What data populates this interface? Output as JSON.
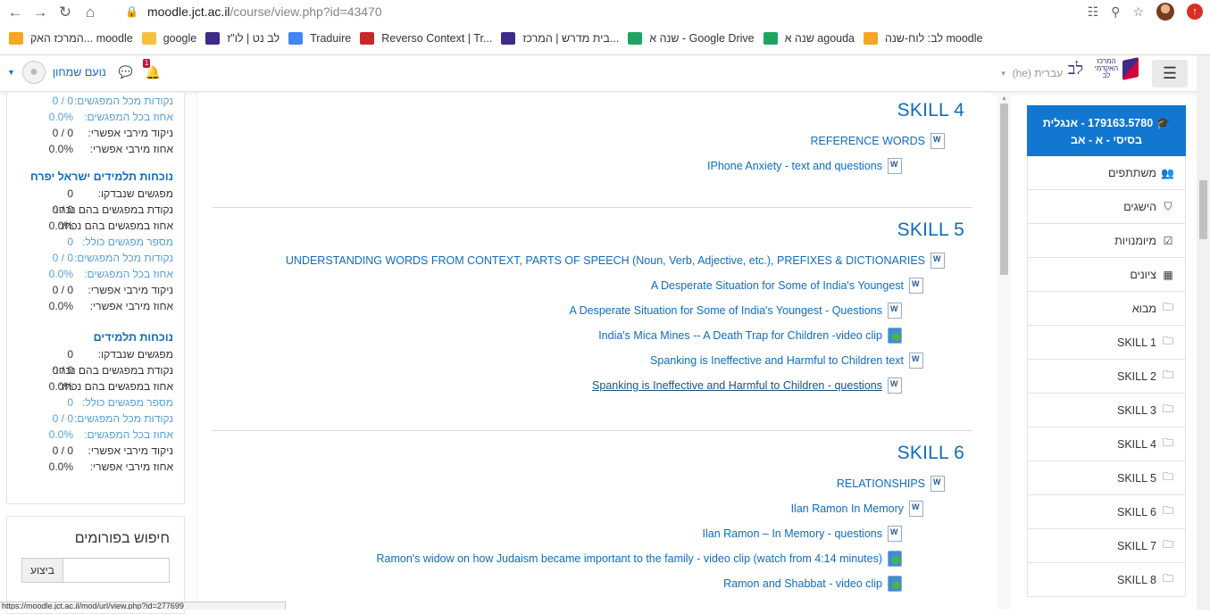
{
  "browser": {
    "url_host": "moodle.jct.ac.il",
    "url_path": "/course/view.php?id=43470",
    "bookmarks": [
      {
        "label": "לב: לוח-שנה moodle",
        "color": "#f5a623"
      },
      {
        "label": "שנה א agouda",
        "color": "#1fa463"
      },
      {
        "label": "שנה א - Google Drive",
        "color": "#1fa463"
      },
      {
        "label": "בית מדרש | המרכז...",
        "color": "#3e2b86"
      },
      {
        "label": "Reverso Context | Tr...",
        "color": "#c62828"
      },
      {
        "label": "Traduire",
        "color": "#4285f4"
      },
      {
        "label": "לב נט | לו\"ז",
        "color": "#3e2b86"
      },
      {
        "label": "google",
        "color": "#f6c23e"
      },
      {
        "label": "המרכז האק... moodle",
        "color": "#f5a623"
      }
    ],
    "status_url": "https://moodle.jct.ac.il/mod/url/view.php?id=277699"
  },
  "navbar": {
    "brand_text": "המרכז האקדמי לב",
    "brand_lev": "לב",
    "language": "עברית (he)",
    "user_name": "נועם שמחון",
    "notifications_count": "1"
  },
  "left_panel": {
    "rows_top": [
      {
        "label": "נקודות מכל המפגשים:",
        "value": "0 / 0",
        "muted": true
      },
      {
        "label": "אחוז בכל המפגשים:",
        "value": "0.0%",
        "muted": true
      },
      {
        "label": "ניקוד מירבי אפשרי:",
        "value": "0 / 0",
        "muted": false
      },
      {
        "label": "אחוז מירבי אפשרי:",
        "value": "0.0%",
        "muted": false
      }
    ],
    "group1_title": "נוכחות תלמידים ישראל יפרח",
    "group1_rows": [
      {
        "label": "מפגשים שנבדקו:",
        "value": "0",
        "muted": false
      },
      {
        "label": "נקודת במפגשים בהם נכחו:",
        "value": "0 / 0",
        "muted": false
      },
      {
        "label": "אחוז במפגשים בהם נכחו:",
        "value": "0.0%",
        "muted": false
      },
      {
        "label": "מספר מפגשים כולל:",
        "value": "0",
        "muted": true
      },
      {
        "label": "נקודות מכל המפגשים:",
        "value": "0 / 0",
        "muted": true
      },
      {
        "label": "אחוז בכל המפגשים:",
        "value": "0.0%",
        "muted": true
      },
      {
        "label": "ניקוד מירבי אפשרי:",
        "value": "0 / 0",
        "muted": false
      },
      {
        "label": "אחוז מירבי אפשרי:",
        "value": "0.0%",
        "muted": false
      }
    ],
    "group2_title": "נוכחות תלמידים",
    "group2_rows": [
      {
        "label": "מפגשים שנבדקו:",
        "value": "0",
        "muted": false
      },
      {
        "label": "נקודת במפגשים בהם נכחו:",
        "value": "0 / 0",
        "muted": false
      },
      {
        "label": "אחוז במפגשים בהם נכחו:",
        "value": "0.0%",
        "muted": false
      },
      {
        "label": "מספר מפגשים כולל:",
        "value": "0",
        "muted": true
      },
      {
        "label": "נקודות מכל המפגשים:",
        "value": "0 / 0",
        "muted": true
      },
      {
        "label": "אחוז בכל המפגשים:",
        "value": "0.0%",
        "muted": true
      },
      {
        "label": "ניקוד מירבי אפשרי:",
        "value": "0 / 0",
        "muted": false
      },
      {
        "label": "אחוז מירבי אפשרי:",
        "value": "0.0%",
        "muted": false
      }
    ],
    "search_title": "חיפוש בפורומים",
    "search_button": "ביצוע"
  },
  "sections": [
    {
      "title": "SKILL 4",
      "activities": [
        {
          "label": "REFERENCE WORDS",
          "icon": "word-icon",
          "type": "word"
        },
        {
          "label": "IPhone Anxiety - text and questions",
          "icon": "word-icon",
          "type": "word",
          "indent": true
        }
      ]
    },
    {
      "title": "SKILL 5",
      "activities": [
        {
          "label": "UNDERSTANDING WORDS FROM CONTEXT, PARTS OF SPEECH (Noun, Verb, Adjective, etc.), PREFIXES & DICTIONARIES",
          "icon": "word-icon",
          "type": "word"
        },
        {
          "label": "A Desperate Situation for Some of India's Youngest",
          "icon": "word-icon",
          "type": "word",
          "indent1": true
        },
        {
          "label": "A Desperate Situation for Some of India's Youngest - Questions",
          "icon": "word-icon",
          "type": "word",
          "indent": true
        },
        {
          "label": "India's Mica Mines -- A Death Trap for Children -video clip",
          "icon": "url-icon",
          "type": "url",
          "indent": true
        },
        {
          "label": "Spanking is Ineffective and Harmful to Children text",
          "icon": "word-icon",
          "type": "word",
          "indent1": true
        },
        {
          "label": "Spanking is Ineffective and Harmful to Children - questions",
          "icon": "word-icon",
          "type": "word",
          "indent": true,
          "hover": true
        }
      ]
    },
    {
      "title": "SKILL 6",
      "activities": [
        {
          "label": "RELATIONSHIPS",
          "icon": "word-icon",
          "type": "word"
        },
        {
          "label": "Ilan Ramon In Memory",
          "icon": "word-icon",
          "type": "word",
          "indent1": true
        },
        {
          "label": "Ilan Ramon – In Memory - questions",
          "icon": "word-icon",
          "type": "word",
          "indent": true
        },
        {
          "label": "Ramon's widow on how Judaism became important to the family - video clip (watch from 4:14 minutes)",
          "icon": "url-icon",
          "type": "url",
          "indent": true
        },
        {
          "label": "Ramon and Shabbat - video clip",
          "icon": "url-icon",
          "type": "url",
          "indent": true
        }
      ]
    }
  ],
  "drawer": {
    "course_title": "179163.5780 - אנגלית בסיסי - א - אב",
    "items": [
      {
        "label": "משתתפים",
        "icon": "users-icon",
        "glyph": "👥"
      },
      {
        "label": "הישגים",
        "icon": "shield-icon",
        "glyph": "⛉"
      },
      {
        "label": "מיומנויות",
        "icon": "checkbox-icon",
        "glyph": "☑"
      },
      {
        "label": "ציונים",
        "icon": "table-icon",
        "glyph": "▦"
      },
      {
        "label": "מבוא",
        "icon": "folder-icon",
        "glyph": "🗀"
      },
      {
        "label": "SKILL 1",
        "icon": "folder-icon",
        "glyph": "🗀"
      },
      {
        "label": "SKILL 2",
        "icon": "folder-icon",
        "glyph": "🗀"
      },
      {
        "label": "SKILL 3",
        "icon": "folder-icon",
        "glyph": "🗀"
      },
      {
        "label": "SKILL 4",
        "icon": "folder-icon",
        "glyph": "🗀"
      },
      {
        "label": "SKILL 5",
        "icon": "folder-icon",
        "glyph": "🗀"
      },
      {
        "label": "SKILL 6",
        "icon": "folder-icon",
        "glyph": "🗀"
      },
      {
        "label": "SKILL 7",
        "icon": "folder-icon",
        "glyph": "🗀"
      },
      {
        "label": "SKILL 8",
        "icon": "folder-icon",
        "glyph": "🗀"
      }
    ]
  }
}
